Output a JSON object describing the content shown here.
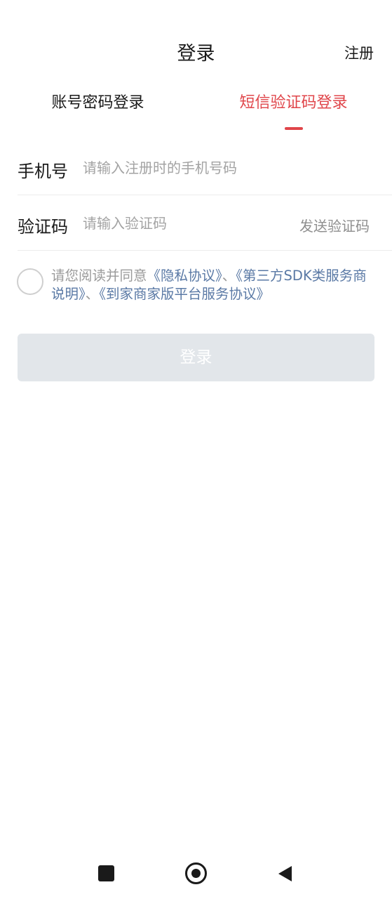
{
  "header": {
    "title": "登录",
    "register_label": "注册"
  },
  "tabs": [
    {
      "label": "账号密码登录",
      "active": false
    },
    {
      "label": "短信验证码登录",
      "active": true
    }
  ],
  "form": {
    "phone": {
      "label": "手机号",
      "placeholder": "请输入注册时的手机号码",
      "value": ""
    },
    "code": {
      "label": "验证码",
      "placeholder": "请输入验证码",
      "value": "",
      "send_label": "发送验证码"
    }
  },
  "agreement": {
    "checked": false,
    "prefix": "请您阅读并同意",
    "privacy": "《隐私协议》",
    "separator1": "、",
    "third_party": "《第三方SDK类服务商说明》",
    "separator2": "、",
    "platform": "《到家商家版平台服务协议》"
  },
  "login_button": {
    "label": "登录",
    "enabled": false
  },
  "colors": {
    "accent": "#e0454a",
    "link": "#5a79a5",
    "button_disabled_bg": "#e2e6ea",
    "muted_text": "#9a9a9a"
  },
  "nav_icons": [
    "recents-square-icon",
    "home-circle-icon",
    "back-triangle-icon"
  ]
}
